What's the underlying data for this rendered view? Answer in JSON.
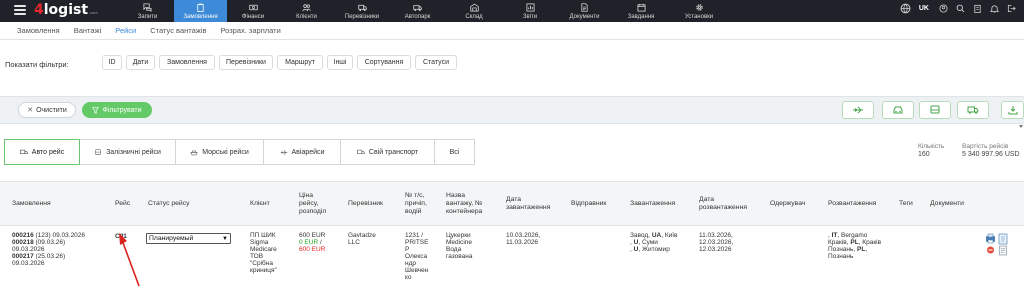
{
  "header": {
    "logo_main": "4",
    "logo_text": "logist",
    "logo_suffix": ".com",
    "lang": "UK",
    "nav": [
      {
        "label": "Запити",
        "icon": "chat-icon",
        "active": false
      },
      {
        "label": "Замовлення",
        "icon": "clipboard-icon",
        "active": true
      },
      {
        "label": "Фінанси",
        "icon": "money-icon",
        "active": false
      },
      {
        "label": "Клієнти",
        "icon": "users-icon",
        "active": false
      },
      {
        "label": "Перевізники",
        "icon": "truck-icon",
        "active": false
      },
      {
        "label": "Автопарк",
        "icon": "fleet-icon",
        "active": false
      },
      {
        "label": "Склад",
        "icon": "warehouse-icon",
        "active": false
      },
      {
        "label": "Звіти",
        "icon": "chart-icon",
        "active": false
      },
      {
        "label": "Документи",
        "icon": "document-icon",
        "active": false
      },
      {
        "label": "Завдання",
        "icon": "calendar-icon",
        "active": false
      },
      {
        "label": "Установки",
        "icon": "gear-icon",
        "active": false
      }
    ]
  },
  "subnav": [
    {
      "label": "Замовлення",
      "active": false
    },
    {
      "label": "Вантажі",
      "active": false
    },
    {
      "label": "Рейси",
      "active": true
    },
    {
      "label": "Статус вантажів",
      "active": false
    },
    {
      "label": "Розрах. зарплати",
      "active": false
    }
  ],
  "filters": {
    "label": "Показати фільтри:",
    "chips": [
      "ID",
      "Дати",
      "Замовлення",
      "Перевізники",
      "Маршрут",
      "Інші",
      "Сортування",
      "Статуси"
    ]
  },
  "actions": {
    "clear": "Очистити",
    "filter": "Фільтрувати",
    "excel": "Excel"
  },
  "tabs": [
    {
      "label": "Авто рейс",
      "icon": "truck-icon",
      "active": true
    },
    {
      "label": "Залізничні рейси",
      "icon": "train-icon",
      "active": false
    },
    {
      "label": "Морські рейси",
      "icon": "ship-icon",
      "active": false
    },
    {
      "label": "Авіарейси",
      "icon": "plane-icon",
      "active": false
    },
    {
      "label": "Свій транспорт",
      "icon": "truck-icon",
      "active": false
    },
    {
      "label": "Всі",
      "icon": "",
      "active": false
    }
  ],
  "stats": {
    "count_label": "Кількість",
    "count_value": "160",
    "cost_label": "Вартість рейсів",
    "cost_value": "5 340 997.96 USD"
  },
  "table": {
    "headers": {
      "orders": "Замовлення",
      "trip": "Рейс",
      "status": "Статус рейсу",
      "client": "Клієнт",
      "price_1": "Ціна",
      "price_2": "рейсу,",
      "price_3": "розподіл",
      "carrier": "Перевізник",
      "vehicle_1": "№ т/с,",
      "vehicle_2": "причіп,",
      "vehicle_3": "водій",
      "cargo_1": "Назва",
      "cargo_2": "вантажу, №",
      "cargo_3": "контейнера",
      "loaddate_1": "Дата",
      "loaddate_2": "завантаження",
      "sender": "Відправник",
      "loading": "Завантаження",
      "unloaddate_1": "Дата",
      "unloaddate_2": "розвантаження",
      "receiver": "Одержувач",
      "unloading": "Розвантаження",
      "tags": "Теги",
      "docs": "Документи"
    },
    "row": {
      "order1_id": "000216",
      "order1_rest": "(123) 09.03.2026",
      "order2_id": "000218",
      "order2_rest": "(09.03.26)",
      "order2_date": "09.03.2026",
      "order3_id": "000217",
      "order3_rest": "(25.03.26)",
      "order3_date": "09.03.2026",
      "trip": "C91",
      "status": "Планируемый",
      "client_1": "ПП ШИК",
      "client_2": "Sigma",
      "client_3": "Medicare",
      "client_4": "ТОВ",
      "client_5": "\"Срібна",
      "client_6": "криниця\"",
      "price_total": "600 EUR",
      "price_green": "0 EUR",
      "price_sep": "/",
      "price_red": "600 EUR",
      "carrier": "Gavtadze",
      "carrier_2": "LLC",
      "vehicle_1": "1231 /",
      "vehicle_2": "PRITSE",
      "vehicle_3": "P",
      "vehicle_4": "Олекса",
      "vehicle_5": "ндр",
      "vehicle_6": "Шевчен",
      "vehicle_7": "ко",
      "cargo_1": "Цукерки",
      "cargo_2": "Medicine",
      "cargo_3": "Вода",
      "cargo_4": "газована",
      "loaddate_1": "10.03.2026,",
      "loaddate_2": "11.03.2026",
      "loading_1a": "Завод, ",
      "loading_1b": "UA",
      "loading_1c": ", Київ",
      "loading_2a": ", ",
      "loading_2b": "U",
      "loading_2c": ", Суми",
      "loading_3a": ", ",
      "loading_3b": "U",
      "loading_3c": ", Житомир",
      "unloaddate_1": "11.03.2026,",
      "unloaddate_2": "12.03.2026,",
      "unloaddate_3": "12.03.2026",
      "unloading_1a": ", ",
      "unloading_1b": "IT",
      "unloading_1c": ", Bergamo",
      "unloading_2a": "Краків, ",
      "unloading_2b": "PL",
      "unloading_2c": ", Краків",
      "unloading_3a": "Познань, ",
      "unloading_3b": "PL",
      "unloading_3c": ",",
      "unloading_4": "Познань"
    }
  },
  "colors": {
    "topbar": "#1f2329",
    "active_nav": "#3d8ad8",
    "green": "#64c967",
    "red": "#e52521"
  }
}
